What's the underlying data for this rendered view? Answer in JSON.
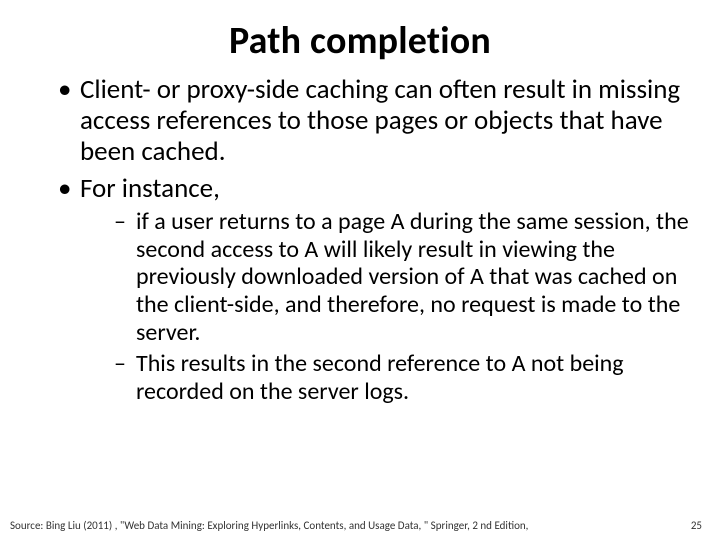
{
  "title": "Path completion",
  "bullets": {
    "b1": "Client- or proxy-side caching can often result in missing access references to those pages or objects that have been cached.",
    "b2": "For instance,",
    "sub1": "if a user returns to a page A during the same session, the second access to A will likely result in viewing the previously downloaded version of A that was cached on the client-side, and therefore, no request is made to the server.",
    "sub2": "This results in the second reference to A not being recorded on the server logs."
  },
  "footer": {
    "source": "Source: Bing Liu (2011) , \"Web Data Mining: Exploring Hyperlinks, Contents, and Usage Data, \" Springer, 2 nd Edition,",
    "page": "25"
  }
}
